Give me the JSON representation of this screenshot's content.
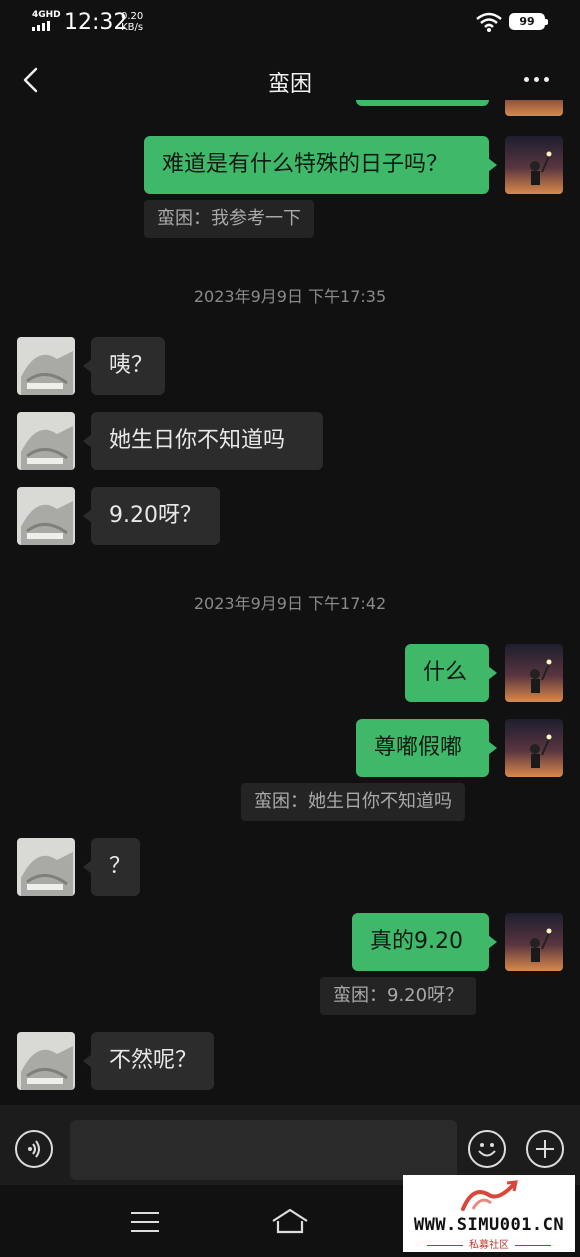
{
  "status_bar": {
    "network": "4GHD",
    "time": "12:32",
    "speed_value": "0.20",
    "speed_unit": "KB/s",
    "battery": "99",
    "icons": [
      "signal-icon",
      "wifi-icon",
      "battery-icon"
    ]
  },
  "header": {
    "title": "蛮困",
    "back_icon": "chevron-left-icon",
    "more_icon": "more-dots-icon"
  },
  "messages": [
    {
      "type": "out",
      "text": "难道是有什么特殊的日子吗？"
    },
    {
      "type": "quote",
      "text": "蛮困：我参考一下"
    },
    {
      "type": "timestamp",
      "text": "2023年9月9日 下午17:35"
    },
    {
      "type": "in",
      "text": "咦？"
    },
    {
      "type": "in",
      "text": "她生日你不知道吗"
    },
    {
      "type": "in",
      "text": "9.20呀？"
    },
    {
      "type": "timestamp",
      "text": "2023年9月9日 下午17:42"
    },
    {
      "type": "out",
      "text": "什么"
    },
    {
      "type": "out",
      "text": "尊嘟假嘟"
    },
    {
      "type": "quote",
      "text": "蛮困：她生日你不知道吗"
    },
    {
      "type": "in",
      "text": "？"
    },
    {
      "type": "out",
      "text": "真的9.20"
    },
    {
      "type": "quote",
      "text": "蛮困：9.20呀？"
    },
    {
      "type": "in",
      "text": "不然呢？"
    }
  ],
  "input_bar": {
    "input_value": "",
    "icons": [
      "voice-icon",
      "emoji-icon",
      "plus-icon"
    ]
  },
  "nav_bar": {
    "icons": [
      "menu-icon",
      "home-icon"
    ]
  },
  "watermark": {
    "url": "WWW.SIMU001.CN",
    "subtitle": "私募社区"
  },
  "colors": {
    "background": "#111111",
    "outgoing_bubble": "#3fb86a",
    "incoming_bubble": "#2c2c2c",
    "quote_background": "#242424",
    "timestamp_text": "#8a8a8a"
  }
}
